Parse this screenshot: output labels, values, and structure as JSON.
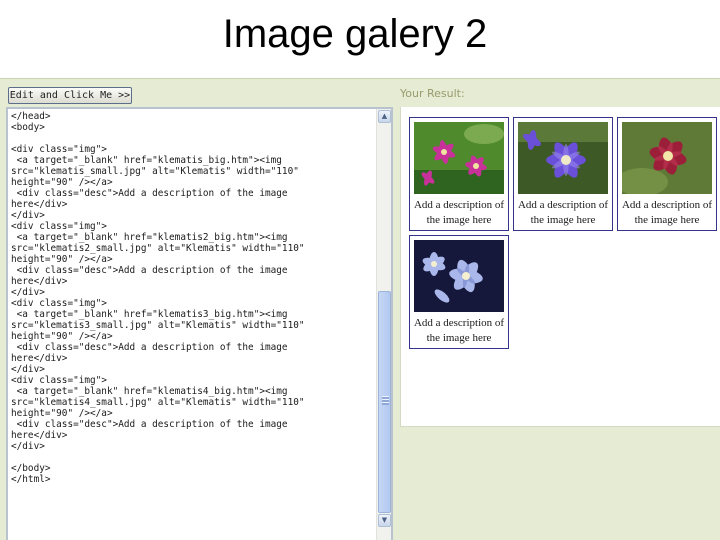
{
  "slide": {
    "title": "Image galery 2"
  },
  "editor": {
    "run_button_label": "Edit and Click Me >>",
    "result_label": "Your Result:",
    "scroll_up_glyph": "▲",
    "scroll_down_glyph": "▼",
    "code": "</head>\n<body>\n\n<div class=\"img\">\n <a target=\"_blank\" href=\"klematis_big.htm\"><img\nsrc=\"klematis_small.jpg\" alt=\"Klematis\" width=\"110\"\nheight=\"90\" /></a>\n <div class=\"desc\">Add a description of the image\nhere</div>\n</div>\n<div class=\"img\">\n <a target=\"_blank\" href=\"klematis2_big.htm\"><img\nsrc=\"klematis2_small.jpg\" alt=\"Klematis\" width=\"110\"\nheight=\"90\" /></a>\n <div class=\"desc\">Add a description of the image\nhere</div>\n</div>\n<div class=\"img\">\n <a target=\"_blank\" href=\"klematis3_big.htm\"><img\nsrc=\"klematis3_small.jpg\" alt=\"Klematis\" width=\"110\"\nheight=\"90\" /></a>\n <div class=\"desc\">Add a description of the image\nhere</div>\n</div>\n<div class=\"img\">\n <a target=\"_blank\" href=\"klematis4_big.htm\"><img\nsrc=\"klematis4_small.jpg\" alt=\"Klematis\" width=\"110\"\nheight=\"90\" /></a>\n <div class=\"desc\">Add a description of the image\nhere</div>\n</div>\n\n</body>\n</html>"
  },
  "gallery": {
    "items": [
      {
        "desc": "Add a description of the image here",
        "flower_color": "#c8309a",
        "background_color": "#4f8a2c"
      },
      {
        "desc": "Add a description of the image here",
        "flower_color": "#6a4fd9",
        "background_color": "#3d5a26"
      },
      {
        "desc": "Add a description of the image here",
        "flower_color": "#9c1f3a",
        "background_color": "#5f7a36"
      },
      {
        "desc": "Add a description of the image here",
        "flower_color": "#aab7ea",
        "background_color": "#15183a"
      }
    ]
  }
}
